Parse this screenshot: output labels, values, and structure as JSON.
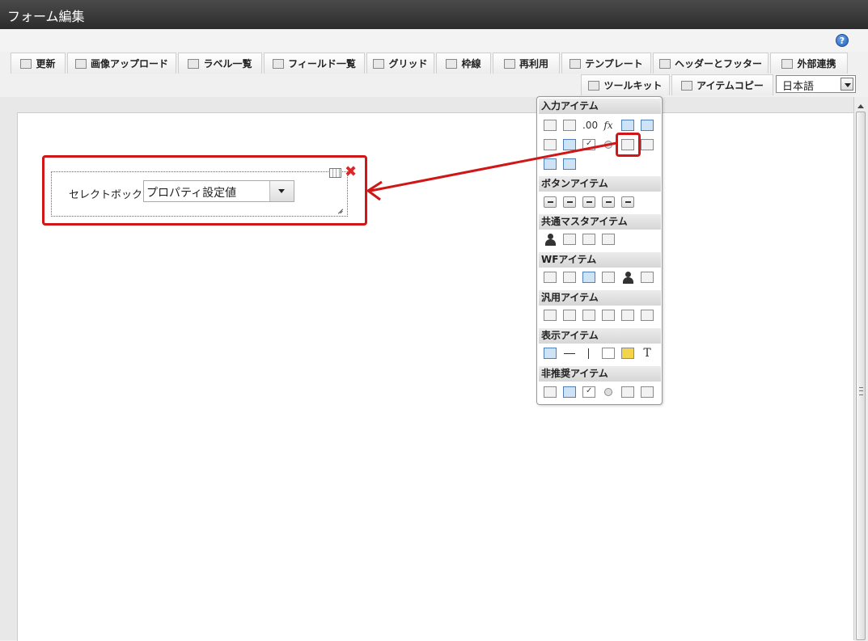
{
  "window": {
    "title": "フォーム編集"
  },
  "toolbar": {
    "row1": [
      {
        "label": "更新",
        "icon": "update-icon"
      },
      {
        "label": "画像アップロード",
        "icon": "image-upload-icon"
      },
      {
        "label": "ラベル一覧",
        "icon": "label-list-icon"
      },
      {
        "label": "フィールド一覧",
        "icon": "field-list-icon"
      },
      {
        "label": "グリッド",
        "icon": "grid-icon"
      },
      {
        "label": "枠線",
        "icon": "border-icon"
      },
      {
        "label": "再利用",
        "icon": "reuse-icon"
      },
      {
        "label": "テンプレート",
        "icon": "template-icon"
      },
      {
        "label": "ヘッダーとフッター",
        "icon": "header-footer-icon"
      },
      {
        "label": "外部連携",
        "icon": "external-link-icon"
      }
    ],
    "row2": [
      {
        "label": "ツールキット",
        "icon": "toolkit-icon"
      },
      {
        "label": "アイテムコピー",
        "icon": "item-copy-icon"
      }
    ],
    "language": "日本語"
  },
  "form_item": {
    "label": "セレクトボックス",
    "select_value": "プロパティ設定値"
  },
  "palette": {
    "sections": [
      {
        "title": "入力アイテム"
      },
      {
        "title": "ボタンアイテム"
      },
      {
        "title": "共通マスタアイテム"
      },
      {
        "title": "WFアイテム"
      },
      {
        "title": "汎用アイテム"
      },
      {
        "title": "表示アイテム"
      },
      {
        "title": "非推奨アイテム"
      }
    ],
    "glyphs": {
      "fx": "fx",
      "num": ".00",
      "text": "T"
    }
  },
  "colors": {
    "highlight": "#d01616",
    "titlebar": "#333333"
  }
}
